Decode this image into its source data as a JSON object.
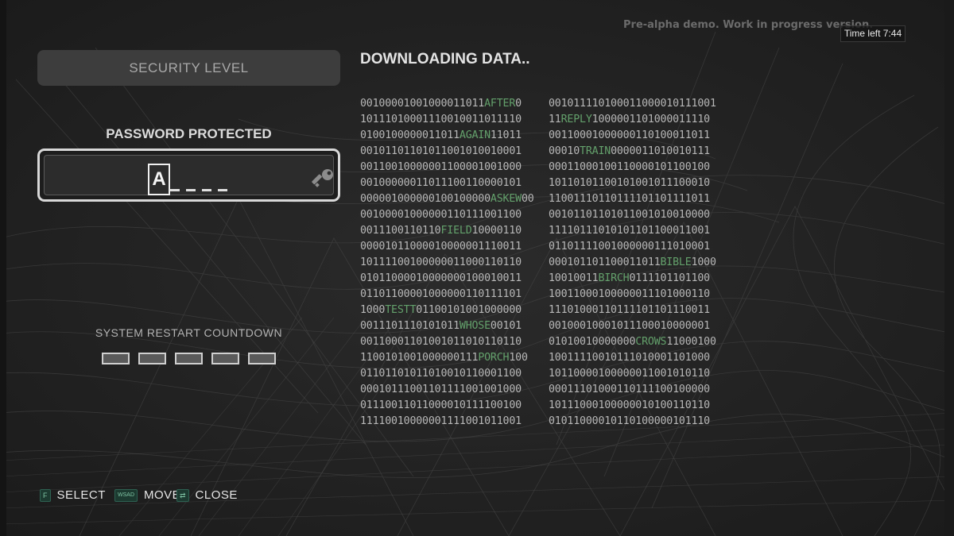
{
  "watermark": "Pre-alpha demo. Work in progress version.",
  "timer": "Time left 7:44",
  "left_panel": {
    "security_level": "SECURITY LEVEL",
    "password_title": "PASSWORD PROTECTED",
    "password_char": "A",
    "countdown_label": "SYSTEM RESTART COUNTDOWN"
  },
  "download_title": "DOWNLOADING DATA..",
  "binary": {
    "left": [
      [
        "00100001001000011011",
        "AFTER",
        "0"
      ],
      [
        "10111010001110010011011110",
        "",
        ""
      ],
      [
        "0100100000011011",
        "AGAIN",
        "11011"
      ],
      [
        "00101101101011001010010001",
        "",
        ""
      ],
      [
        "00110010000001100001001000",
        "",
        ""
      ],
      [
        "00100000011011100110000101",
        "",
        ""
      ],
      [
        "000001000000100100000",
        "ASKEW",
        "00"
      ],
      [
        "00100001000000110111001100",
        "",
        ""
      ],
      [
        "0011100110110",
        "FIELD",
        "10000110"
      ],
      [
        "00001011000010000001110011",
        "",
        ""
      ],
      [
        "10111100100000011000110110",
        "",
        ""
      ],
      [
        "01011000010000000100010011",
        "",
        ""
      ],
      [
        "01101100001000000110111101",
        "",
        ""
      ],
      [
        "1000",
        "TESTT",
        "01100101001000000"
      ],
      [
        "0011101110101011",
        "WHOSE",
        "00101"
      ],
      [
        "00110001101001011010110110",
        "",
        ""
      ],
      [
        "1100101001000000111",
        "PORCH",
        "100"
      ],
      [
        "01101101011010010110001100",
        "",
        ""
      ],
      [
        "00010111001101111001001000",
        "",
        ""
      ],
      [
        "01110011011000010111100100",
        "",
        ""
      ],
      [
        "11110010000001111001011001",
        "",
        ""
      ]
    ],
    "right": [
      [
        "00101111010001100001011100",
        "1",
        ""
      ],
      [
        "11",
        "REPLY",
        "1000001101000011110"
      ],
      [
        "00110001000000110100011011",
        "",
        ""
      ],
      [
        "00010",
        "TRAIN",
        "0000011010010111"
      ],
      [
        "00011000100110000101100100",
        "",
        ""
      ],
      [
        "10110101100101001011100010",
        "",
        ""
      ],
      [
        "11001110110111101101111011",
        "",
        ""
      ],
      [
        "00101101101011001010010000",
        "",
        ""
      ],
      [
        "11110111010101101100011001",
        "",
        ""
      ],
      [
        "01101111001000000111010001",
        "",
        ""
      ],
      [
        "000101101100011011",
        "BIBLE",
        "1000"
      ],
      [
        "10010011",
        "BIRCH",
        "0111101101100"
      ],
      [
        "10011000100000011101000110",
        "",
        ""
      ],
      [
        "11101000110111101101110011",
        "",
        ""
      ],
      [
        "00100010001011100010000001",
        "",
        ""
      ],
      [
        "01010010000000",
        "CROWS",
        "11000100"
      ],
      [
        "10011110010111010001101000",
        "",
        ""
      ],
      [
        "10110000100000011001010110",
        "",
        ""
      ],
      [
        "00011101000110111100100000",
        "",
        ""
      ],
      [
        "10111000100000010100110110",
        "",
        ""
      ],
      [
        "01011000010110100000101110",
        "",
        ""
      ]
    ]
  },
  "hints": [
    {
      "key": "F",
      "label": "SELECT"
    },
    {
      "key": "WSAD",
      "label": "MOVE"
    },
    {
      "key": "⇄",
      "label": "CLOSE"
    }
  ]
}
